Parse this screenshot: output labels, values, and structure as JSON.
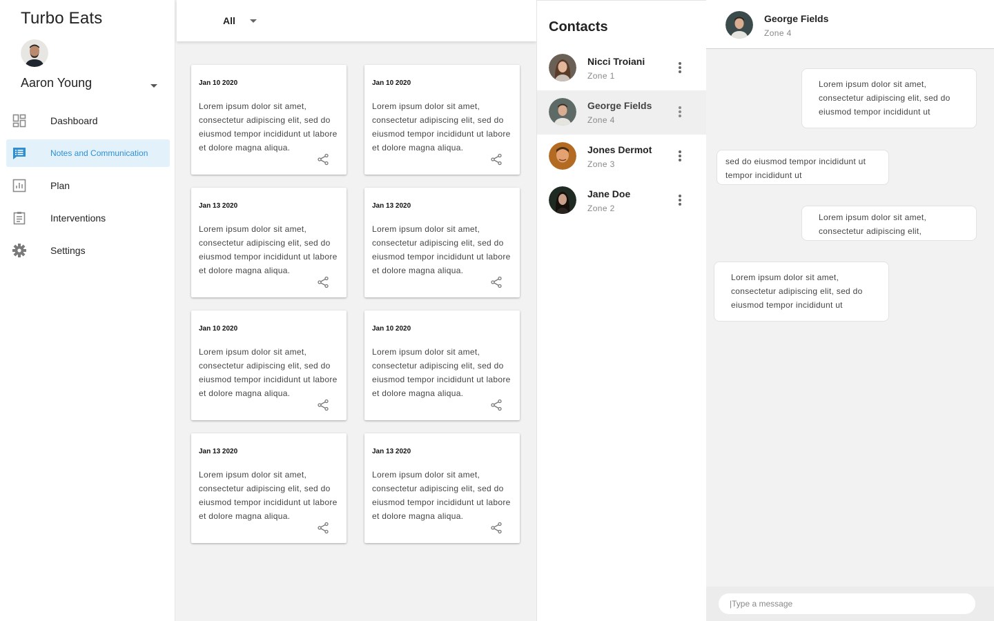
{
  "app": {
    "title": "Turbo Eats"
  },
  "user": {
    "name": "Aaron Young",
    "avatar_icon": "user-avatar"
  },
  "nav": {
    "items": [
      {
        "label": "Dashboard",
        "icon": "dashboard-icon",
        "active": false
      },
      {
        "label": "Notes and Communication",
        "icon": "notes-icon",
        "active": true
      },
      {
        "label": "Plan",
        "icon": "chart-icon",
        "active": false
      },
      {
        "label": "Interventions",
        "icon": "clipboard-icon",
        "active": false
      },
      {
        "label": "Settings",
        "icon": "gear-icon",
        "active": false
      }
    ],
    "accent_color": "#2f8fd3",
    "active_bg": "#e3f1fb"
  },
  "filter": {
    "selected": "All"
  },
  "notes": [
    {
      "date": "Jan 10 2020",
      "body": "Lorem ipsum dolor sit amet, consectetur adipiscing elit, sed do eiusmod tempor incididunt ut labore et dolore magna aliqua."
    },
    {
      "date": "Jan 10 2020",
      "body": "Lorem ipsum dolor sit amet, consectetur adipiscing elit, sed do eiusmod tempor incididunt ut labore et dolore magna aliqua."
    },
    {
      "date": "Jan 13 2020",
      "body": "Lorem ipsum dolor sit amet, consectetur adipiscing elit, sed do eiusmod tempor incididunt ut labore et dolore magna aliqua."
    },
    {
      "date": "Jan 13 2020",
      "body": "Lorem ipsum dolor sit amet, consectetur adipiscing elit, sed do eiusmod tempor incididunt ut labore et dolore magna aliqua."
    },
    {
      "date": "Jan 10 2020",
      "body": "Lorem ipsum dolor sit amet, consectetur adipiscing elit, sed do eiusmod tempor incididunt ut labore et dolore magna aliqua."
    },
    {
      "date": "Jan 10 2020",
      "body": "Lorem ipsum dolor sit amet, consectetur adipiscing elit, sed do eiusmod tempor incididunt ut labore et dolore magna aliqua."
    },
    {
      "date": "Jan 13 2020",
      "body": "Lorem ipsum dolor sit amet, consectetur adipiscing elit, sed do eiusmod tempor incididunt ut labore et dolore magna aliqua."
    },
    {
      "date": "Jan 13 2020",
      "body": "Lorem ipsum dolor sit amet, consectetur adipiscing elit, sed do eiusmod tempor incididunt ut labore et dolore magna aliqua."
    }
  ],
  "contacts": {
    "title": "Contacts",
    "items": [
      {
        "name": "Nicci Troiani",
        "zone": "Zone 1",
        "selected": false
      },
      {
        "name": "George Fields",
        "zone": "Zone 4",
        "selected": true
      },
      {
        "name": "Jones Dermot",
        "zone": "Zone 3",
        "selected": false
      },
      {
        "name": "Jane Doe",
        "zone": "Zone 2",
        "selected": false
      }
    ]
  },
  "chat": {
    "name": "George Fields",
    "zone": "Zone 4",
    "messages": [
      {
        "from": "me",
        "text": "Lorem ipsum dolor sit amet, consectetur adipiscing elit, sed do eiusmod tempor incididunt ut"
      },
      {
        "from": "them",
        "text": "sed do eiusmod tempor incididunt ut tempor incididunt ut"
      },
      {
        "from": "me",
        "text": "Lorem ipsum dolor sit amet, consectetur adipiscing elit,"
      },
      {
        "from": "them",
        "text": "Lorem ipsum dolor sit amet, consectetur adipiscing elit, sed do eiusmod tempor incididunt ut"
      }
    ],
    "input_placeholder": "|Type a message"
  }
}
